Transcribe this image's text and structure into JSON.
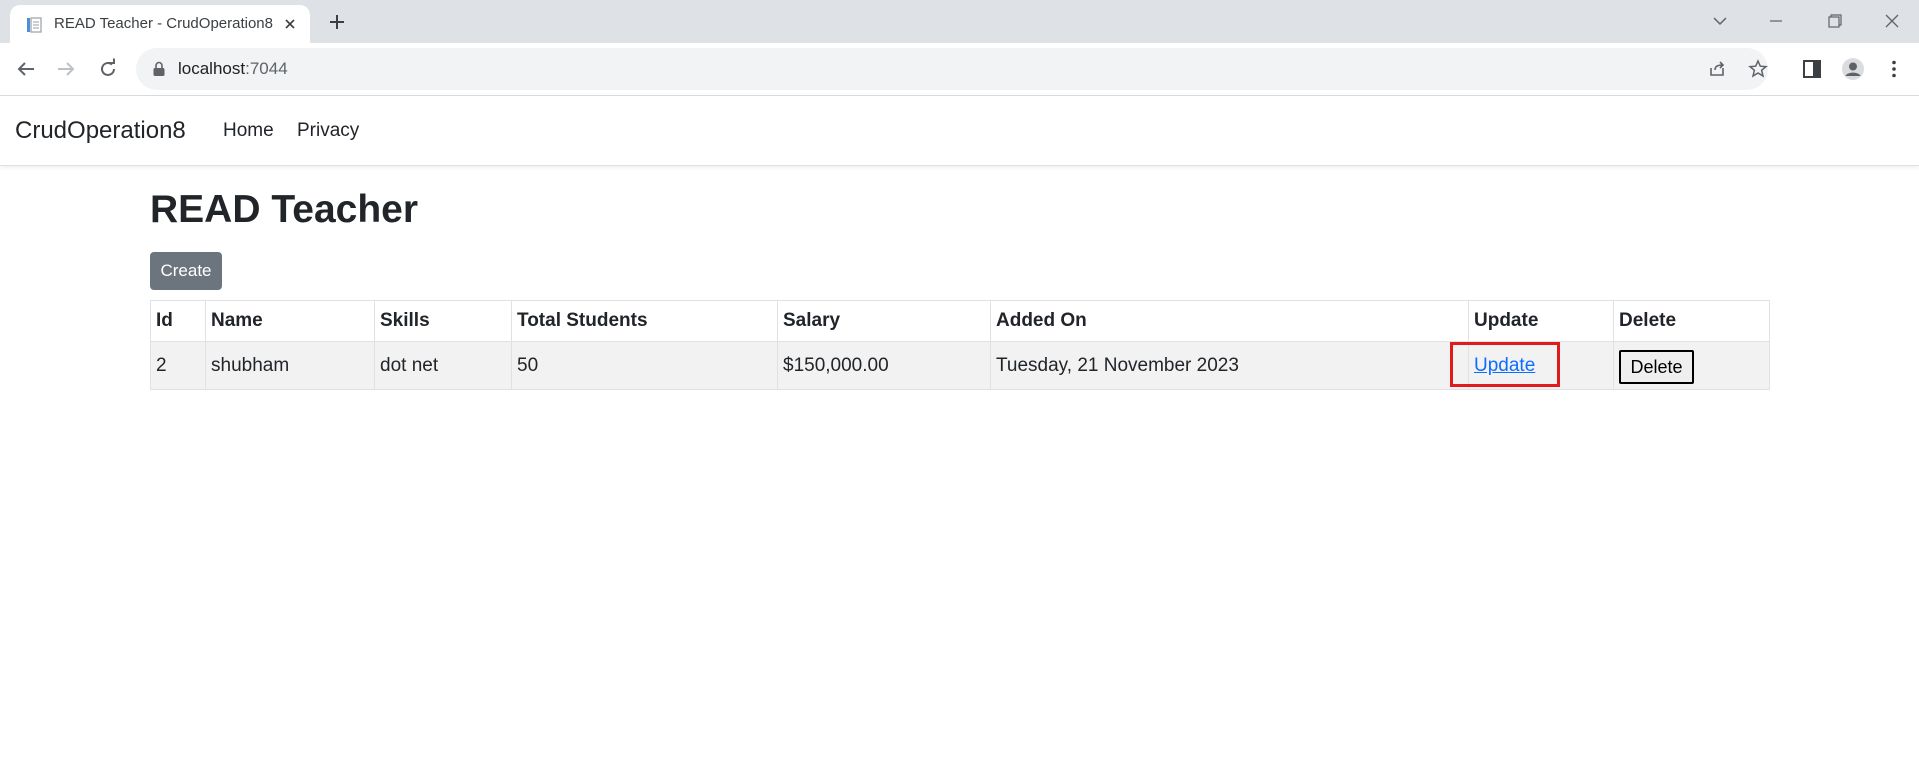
{
  "browser": {
    "tab_title": "READ Teacher - CrudOperation8",
    "url_host": "localhost",
    "url_port": ":7044"
  },
  "navbar": {
    "brand": "CrudOperation8",
    "links": [
      "Home",
      "Privacy"
    ]
  },
  "page": {
    "title": "READ Teacher",
    "create_label": "Create"
  },
  "table": {
    "columns": [
      "Id",
      "Name",
      "Skills",
      "Total Students",
      "Salary",
      "Added On",
      "Update",
      "Delete"
    ],
    "rows": [
      {
        "id": "2",
        "name": "shubham",
        "skills": "dot net",
        "total_students": "50",
        "salary": "$150,000.00",
        "added_on": "Tuesday, 21 November 2023",
        "update_label": "Update",
        "delete_label": "Delete"
      }
    ]
  },
  "colors": {
    "highlight": "#e01b1b",
    "create_button": "#6c757d",
    "link": "#0d6efd"
  }
}
